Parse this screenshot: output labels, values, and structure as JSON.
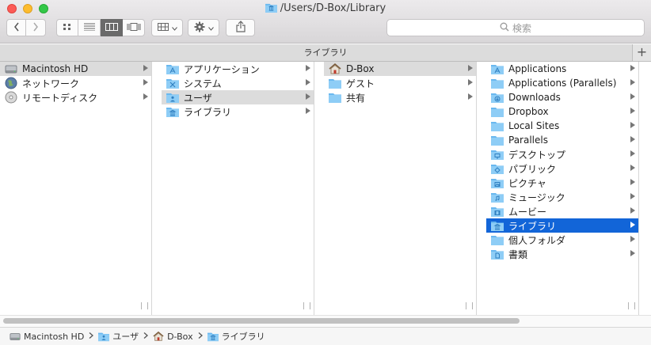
{
  "window": {
    "title": "/Users/D-Box/Library"
  },
  "toolbar": {
    "search_placeholder": "検索"
  },
  "pathbar": {
    "label": "ライブラリ",
    "add_tab": "+"
  },
  "columns": [
    {
      "items": [
        {
          "label": "Macintosh HD",
          "icon": "hard-drive-icon",
          "selected": "gray"
        },
        {
          "label": "ネットワーク",
          "icon": "network-globe-icon"
        },
        {
          "label": "リモートディスク",
          "icon": "remote-disc-icon"
        }
      ]
    },
    {
      "items": [
        {
          "label": "アプリケーション",
          "icon": "applications-folder-icon"
        },
        {
          "label": "システム",
          "icon": "system-folder-icon"
        },
        {
          "label": "ユーザ",
          "icon": "users-folder-icon",
          "selected": "gray"
        },
        {
          "label": "ライブラリ",
          "icon": "library-folder-icon"
        }
      ]
    },
    {
      "items": [
        {
          "label": "D-Box",
          "icon": "home-icon",
          "selected": "gray"
        },
        {
          "label": "ゲスト",
          "icon": "folder-icon"
        },
        {
          "label": "共有",
          "icon": "folder-icon"
        }
      ]
    },
    {
      "items": [
        {
          "label": "Applications",
          "icon": "applications-folder-icon"
        },
        {
          "label": "Applications (Parallels)",
          "icon": "folder-icon"
        },
        {
          "label": "Downloads",
          "icon": "downloads-folder-icon"
        },
        {
          "label": "Dropbox",
          "icon": "folder-icon"
        },
        {
          "label": "Local Sites",
          "icon": "folder-icon"
        },
        {
          "label": "Parallels",
          "icon": "folder-icon"
        },
        {
          "label": "デスクトップ",
          "icon": "desktop-folder-icon"
        },
        {
          "label": "パブリック",
          "icon": "public-folder-icon"
        },
        {
          "label": "ピクチャ",
          "icon": "pictures-folder-icon"
        },
        {
          "label": "ミュージック",
          "icon": "music-folder-icon"
        },
        {
          "label": "ムービー",
          "icon": "movies-folder-icon"
        },
        {
          "label": "ライブラリ",
          "icon": "library-folder-icon",
          "selected": "blue"
        },
        {
          "label": "個人フォルダ",
          "icon": "folder-icon"
        },
        {
          "label": "書類",
          "icon": "documents-folder-icon"
        }
      ]
    }
  ],
  "footer": {
    "crumbs": [
      {
        "label": "Macintosh HD",
        "icon": "hard-drive-icon"
      },
      {
        "label": "ユーザ",
        "icon": "users-folder-icon"
      },
      {
        "label": "D-Box",
        "icon": "home-icon"
      },
      {
        "label": "ライブラリ",
        "icon": "library-folder-icon"
      }
    ]
  },
  "colors": {
    "selection_blue": "#1265d8",
    "folder_blue": "#6ab8ef"
  }
}
